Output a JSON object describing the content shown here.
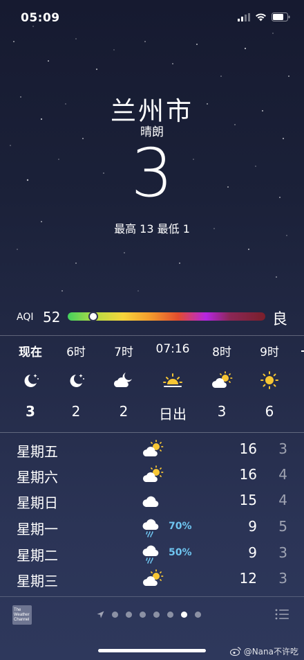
{
  "status_bar": {
    "time": "05:09",
    "icons": [
      "cellular-signal-icon",
      "wifi-icon",
      "battery-icon"
    ]
  },
  "location": {
    "city": "兰州市",
    "condition": "晴朗",
    "temperature": "3",
    "high_low": "最高 13  最低 1"
  },
  "aqi": {
    "label": "AQI",
    "value": "52",
    "level": "良",
    "indicator_fraction": 0.13
  },
  "hourly": [
    {
      "time": "现在",
      "icon": "moon-stars-icon",
      "temp": "3"
    },
    {
      "time": "6时",
      "icon": "moon-stars-icon",
      "temp": "2"
    },
    {
      "time": "7时",
      "icon": "cloud-moon-icon",
      "temp": "2"
    },
    {
      "time": "07:16",
      "icon": "sunrise-icon",
      "temp": "日出"
    },
    {
      "time": "8时",
      "icon": "cloud-sun-icon",
      "temp": "3"
    },
    {
      "time": "9时",
      "icon": "sun-icon",
      "temp": "6"
    }
  ],
  "daily": [
    {
      "day": "星期五",
      "icon": "cloud-sun-icon",
      "precip": "",
      "high": "16",
      "low": "3"
    },
    {
      "day": "星期六",
      "icon": "cloud-sun-icon",
      "precip": "",
      "high": "16",
      "low": "4"
    },
    {
      "day": "星期日",
      "icon": "cloud-icon",
      "precip": "",
      "high": "15",
      "low": "4"
    },
    {
      "day": "星期一",
      "icon": "cloud-rain-icon",
      "precip": "70%",
      "high": "9",
      "low": "5"
    },
    {
      "day": "星期二",
      "icon": "cloud-rain-icon",
      "precip": "50%",
      "high": "9",
      "low": "3"
    },
    {
      "day": "星期三",
      "icon": "cloud-sun-icon",
      "precip": "",
      "high": "12",
      "low": "3"
    }
  ],
  "footer": {
    "logo_text": "The Weather Channel",
    "pages": 7,
    "active_page": 6
  },
  "watermark": "@Nana不许吃",
  "colors": {
    "precip": "#6fc5f0",
    "sun": "#f7c634"
  }
}
